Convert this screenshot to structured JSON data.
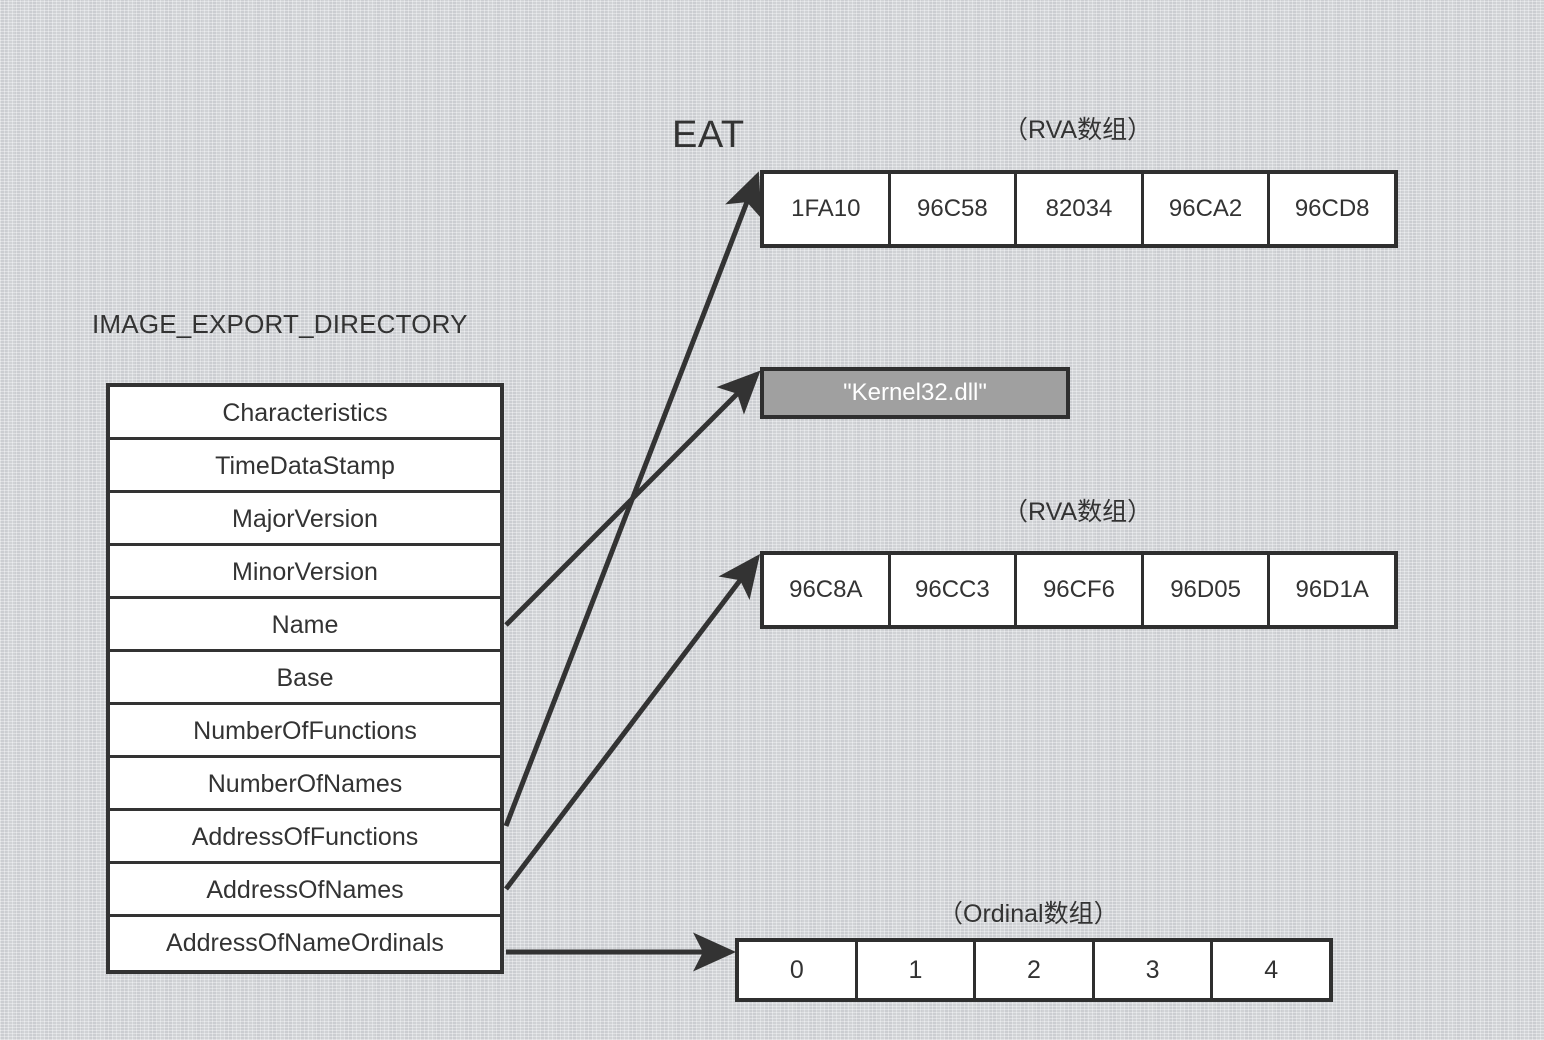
{
  "diagram": {
    "eat_label": "EAT",
    "directory_title": "IMAGE_EXPORT_DIRECTORY",
    "directory_fields": [
      {
        "label": "Characteristics"
      },
      {
        "label": "TimeDataStamp"
      },
      {
        "label": "MajorVersion"
      },
      {
        "label": "MinorVersion"
      },
      {
        "label": "Name"
      },
      {
        "label": "Base"
      },
      {
        "label": "NumberOfFunctions"
      },
      {
        "label": "NumberOfNames"
      },
      {
        "label": "AddressOfFunctions"
      },
      {
        "label": "AddressOfNameOrdinals"
      }
    ],
    "address_of_names_label": "AddressOfNames",
    "captions": {
      "functions_array": "（RVA数组）",
      "names_array": "（RVA数组）",
      "ordinals_array": "（Ordinal数组）"
    },
    "functions_array": {
      "values": [
        "1FA10",
        "96C58",
        "82034",
        "96CA2",
        "96CD8"
      ]
    },
    "names_array": {
      "values": [
        "96C8A",
        "96CC3",
        "96CF6",
        "96D05",
        "96D1A"
      ]
    },
    "ordinals_array": {
      "values": [
        "0",
        "1",
        "2",
        "3",
        "4"
      ]
    },
    "dll_name": "\"Kernel32.dll\"",
    "colors": {
      "background": "#d6d8dc",
      "stroke": "#333333",
      "box_fill": "#ffffff",
      "dll_box_fill": "#a0a0a0",
      "dll_text": "#ffffff"
    }
  }
}
